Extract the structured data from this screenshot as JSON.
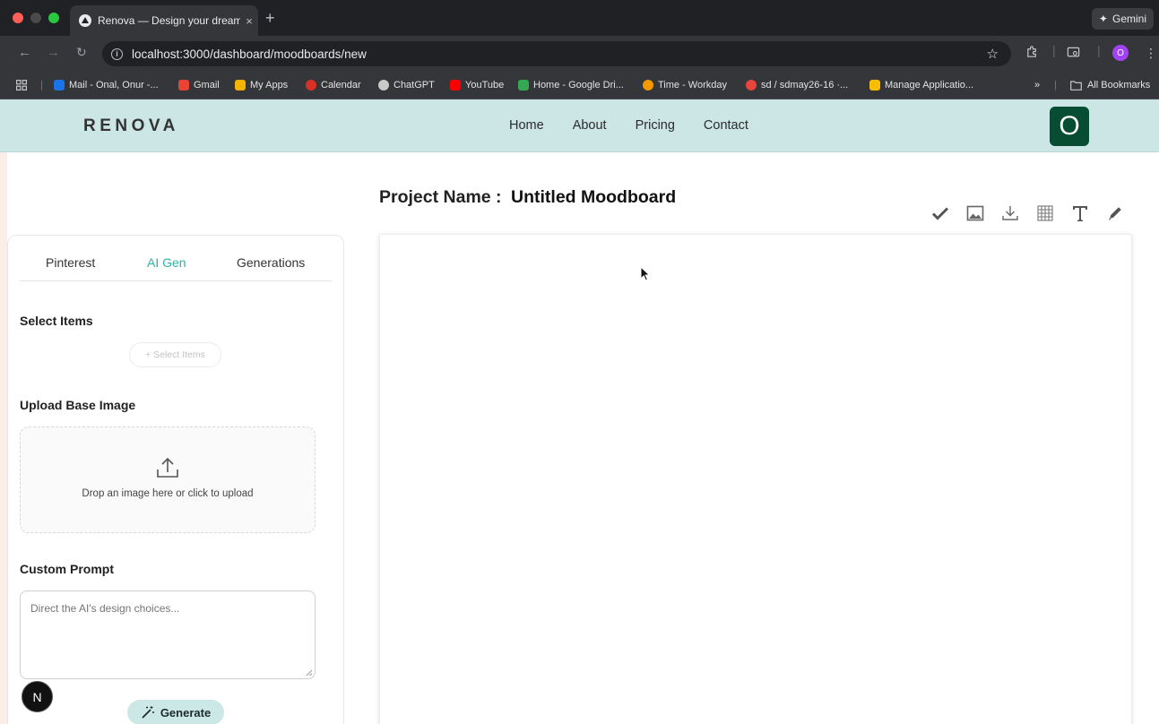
{
  "browser": {
    "tab_title": "Renova — Design your dream",
    "tab_close": "×",
    "new_tab": "+",
    "gemini_label": "Gemini",
    "url": "localhost:3000/dashboard/moodboards/new",
    "profile_initial": "O",
    "bookmarks": [
      {
        "label": "Mail - Onal, Onur -...",
        "color": "#1a73e8"
      },
      {
        "label": "Gmail",
        "color": "#ea4335"
      },
      {
        "label": "My Apps",
        "color": "#f4b400"
      },
      {
        "label": "Calendar",
        "color": "#d93025"
      },
      {
        "label": "ChatGPT",
        "color": "#c9c9c9"
      },
      {
        "label": "YouTube",
        "color": "#ff0000"
      },
      {
        "label": "Home - Google Dri...",
        "color": "#34a853"
      },
      {
        "label": "Time - Workday",
        "color": "#f29900"
      },
      {
        "label": "sd / sdmay26-16 ·...",
        "color": "#e8453c"
      },
      {
        "label": "Manage Applicatio...",
        "color": "#fbbc04"
      }
    ],
    "overflow": "»",
    "all_bookmarks": "All Bookmarks"
  },
  "app": {
    "brand": "RENOVA",
    "nav": [
      "Home",
      "About",
      "Pricing",
      "Contact"
    ],
    "user_initial": "O",
    "project_label": "Project Name :",
    "project_name": "Untitled Moodboard",
    "tools": [
      "check-icon",
      "image-icon",
      "download-icon",
      "grid-icon",
      "text-icon",
      "pen-icon"
    ],
    "panel": {
      "tabs": [
        "Pinterest",
        "AI Gen",
        "Generations"
      ],
      "active_tab": "AI Gen",
      "select_items_title": "Select Items",
      "select_items_button": "+ Select Items",
      "upload_title": "Upload Base Image",
      "upload_text": "Drop an image here or click to upload",
      "prompt_title": "Custom Prompt",
      "prompt_placeholder": "Direct the AI's design choices...",
      "generate_label": "Generate"
    },
    "dev_badge": "N"
  },
  "colors": {
    "nav_bg": "#cce5e5",
    "active_tab": "#2ab3a6",
    "avatar_bg": "#064d34",
    "generate_bg": "#cbe8e6"
  }
}
